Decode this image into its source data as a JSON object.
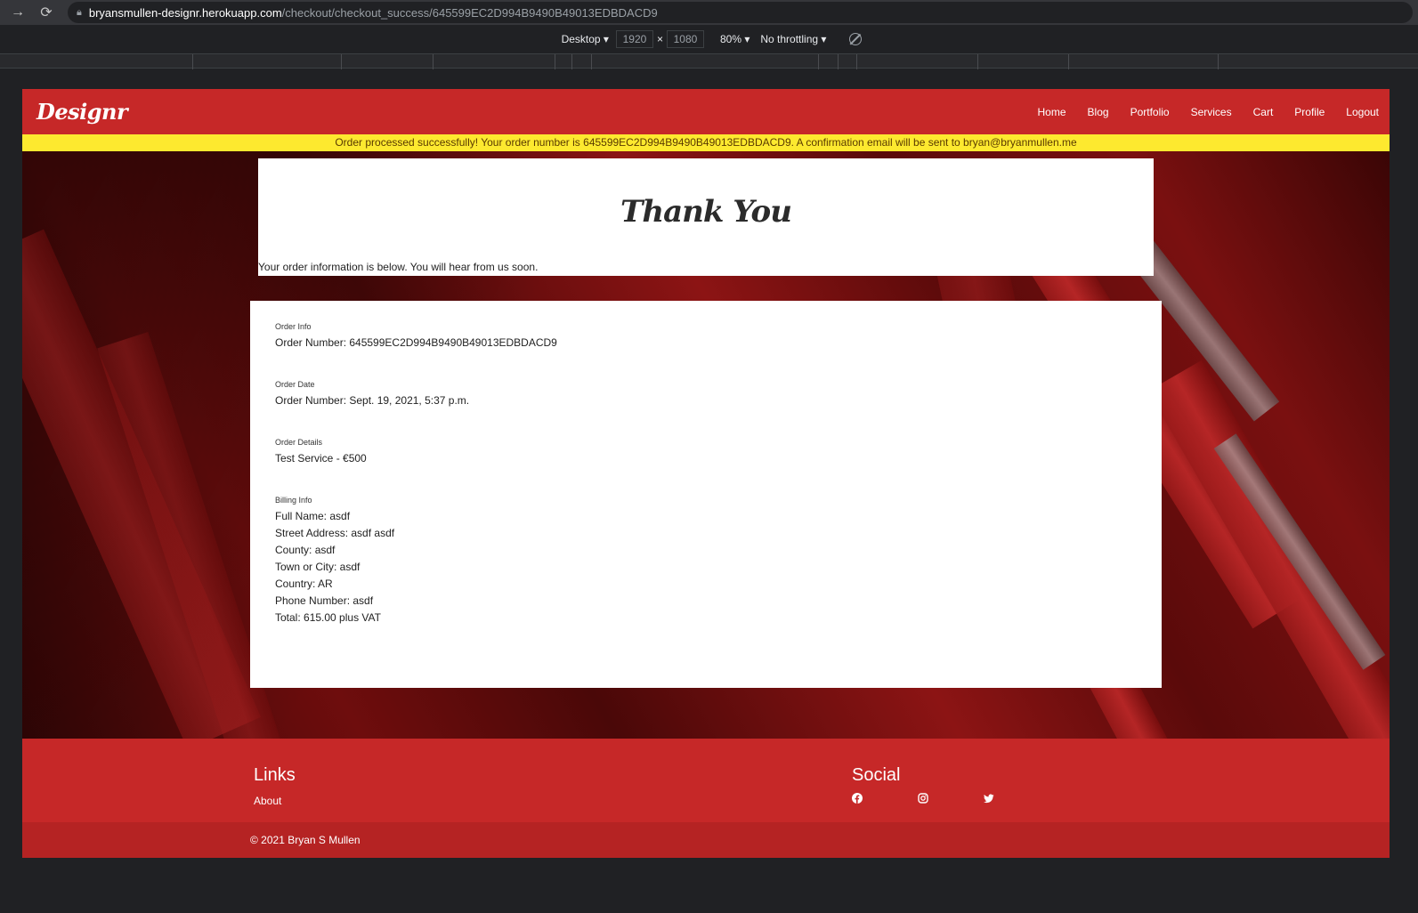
{
  "browser": {
    "url_host": "bryansmullen-designr.herokuapp.com",
    "url_path": "/checkout/checkout_success/645599EC2D994B9490B49013EDBDACD9"
  },
  "devtools": {
    "device": "Desktop",
    "width": "1920",
    "height": "1080",
    "times": "×",
    "zoom": "80%",
    "throttling": "No throttling"
  },
  "header": {
    "logo": "Designr",
    "nav": [
      "Home",
      "Blog",
      "Portfolio",
      "Services",
      "Cart",
      "Profile",
      "Logout"
    ]
  },
  "alert": {
    "message": "Order processed successfully! Your order number is 645599EC2D994B9490B49013EDBDACD9. A confirmation email will be sent to bryan@bryanmullen.me"
  },
  "thanks": {
    "title": "Thank You",
    "subtitle": "Your order information is below. You will hear from us soon."
  },
  "order": {
    "info_label": "Order Info",
    "order_number": "Order Number: 645599EC2D994B9490B49013EDBDACD9",
    "date_label": "Order Date",
    "order_date": "Order Number: Sept. 19, 2021, 5:37 p.m.",
    "details_label": "Order Details",
    "details": "Test Service - €500",
    "billing_label": "Billing Info",
    "billing": [
      "Full Name: asdf",
      "Street Address: asdf asdf",
      "County: asdf",
      "Town or City: asdf",
      "Country: AR",
      "Phone Number: asdf",
      "Total: 615.00 plus VAT"
    ]
  },
  "footer": {
    "links_heading": "Links",
    "about": "About",
    "social_heading": "Social",
    "social_icons": [
      "facebook-icon",
      "instagram-icon",
      "twitter-icon"
    ],
    "copyright": "© 2021 Bryan S Mullen"
  },
  "colors": {
    "brand_red": "#c62828",
    "alert_yellow": "#fde92f"
  }
}
